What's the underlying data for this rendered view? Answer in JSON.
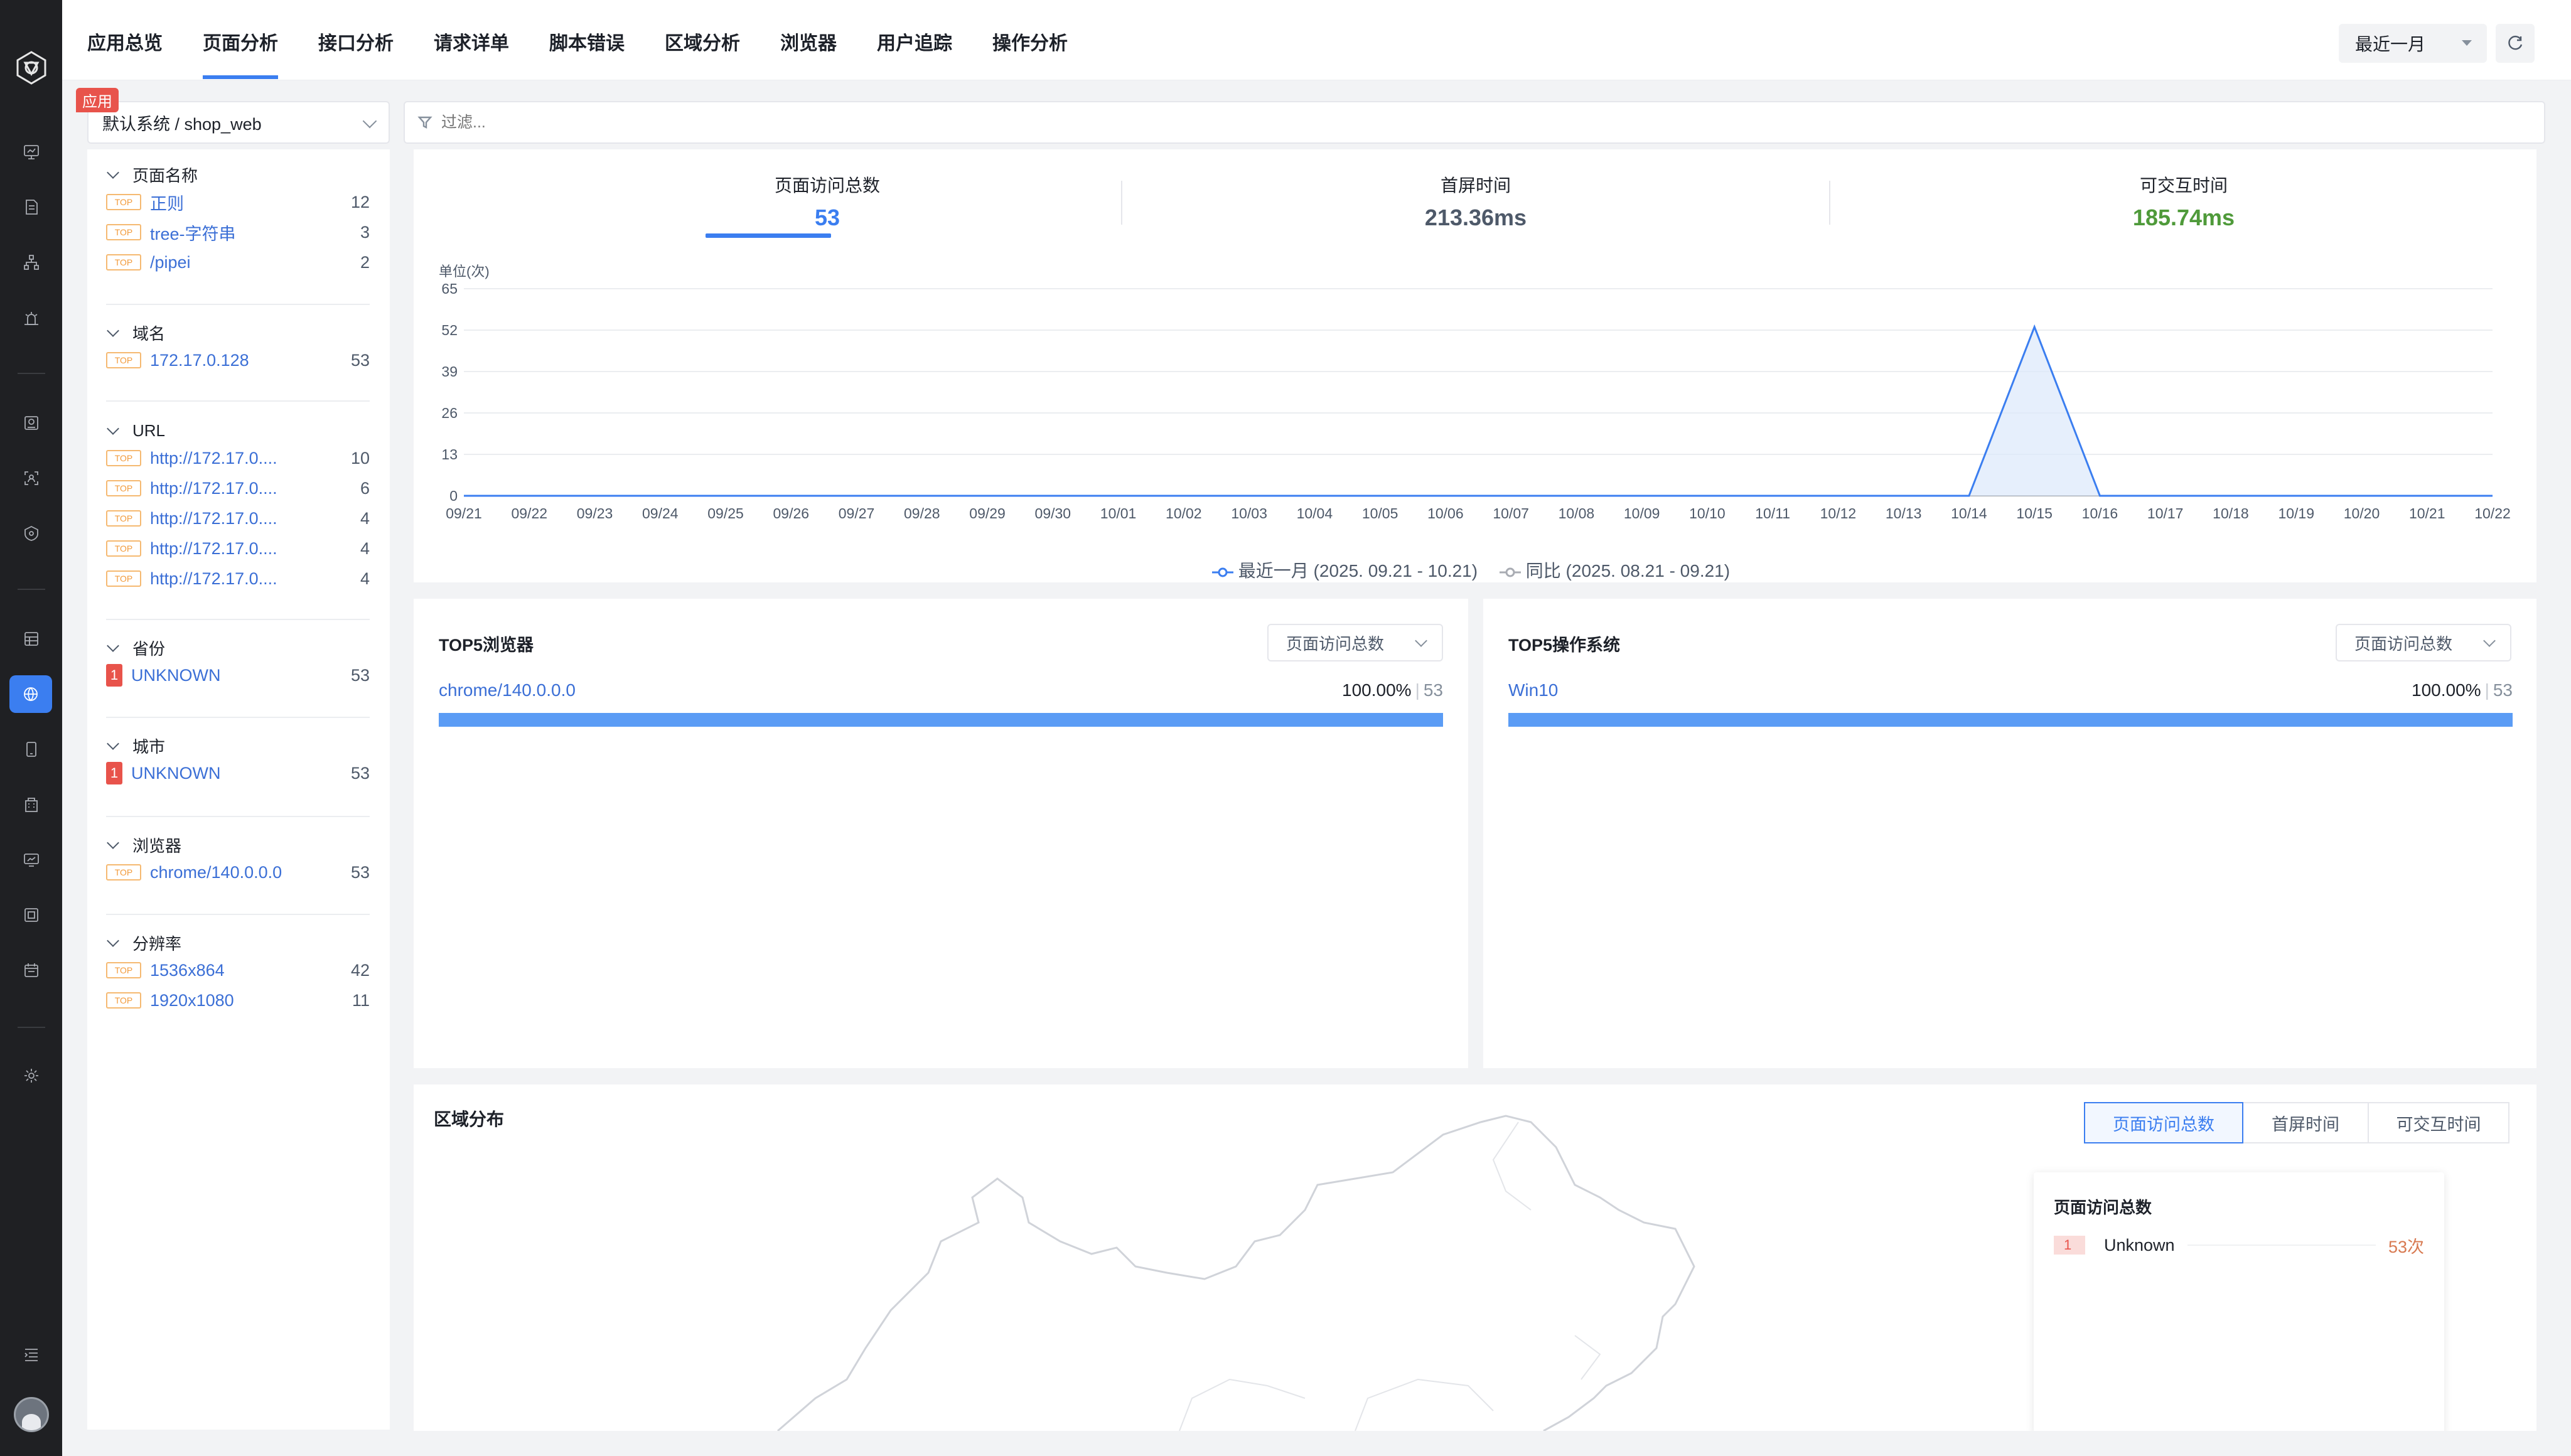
{
  "nav": {
    "tabs": [
      "应用总览",
      "页面分析",
      "接口分析",
      "请求详单",
      "脚本错误",
      "区域分析",
      "浏览器",
      "用户追踪",
      "操作分析"
    ],
    "active_tab": "页面分析",
    "range": "最近一月"
  },
  "app_selector": {
    "badge": "应用",
    "value": "默认系统 / shop_web"
  },
  "filter": {
    "placeholder": "过滤..."
  },
  "facets": [
    {
      "title": "页面名称",
      "rows": [
        {
          "badge": "TOP",
          "label": "正则",
          "count": "12"
        },
        {
          "badge": "TOP",
          "label": "tree-字符串",
          "count": "3"
        },
        {
          "badge": "TOP",
          "label": "/pipei",
          "count": "2"
        }
      ]
    },
    {
      "title": "域名",
      "rows": [
        {
          "badge": "TOP",
          "label": "172.17.0.128",
          "count": "53"
        }
      ]
    },
    {
      "title": "URL",
      "rows": [
        {
          "badge": "TOP",
          "label": "http://172.17.0....",
          "count": "10"
        },
        {
          "badge": "TOP",
          "label": "http://172.17.0....",
          "count": "6"
        },
        {
          "badge": "TOP",
          "label": "http://172.17.0....",
          "count": "4"
        },
        {
          "badge": "TOP",
          "label": "http://172.17.0....",
          "count": "4"
        },
        {
          "badge": "TOP",
          "label": "http://172.17.0....",
          "count": "4"
        }
      ]
    },
    {
      "title": "省份",
      "rows": [
        {
          "badge": "1",
          "label": "UNKNOWN",
          "count": "53"
        }
      ]
    },
    {
      "title": "城市",
      "rows": [
        {
          "badge": "1",
          "label": "UNKNOWN",
          "count": "53"
        }
      ]
    },
    {
      "title": "浏览器",
      "rows": [
        {
          "badge": "TOP",
          "label": "chrome/140.0.0.0",
          "count": "53"
        }
      ]
    },
    {
      "title": "分辨率",
      "rows": [
        {
          "badge": "TOP",
          "label": "1536x864",
          "count": "42"
        },
        {
          "badge": "TOP",
          "label": "1920x1080",
          "count": "11"
        }
      ]
    }
  ],
  "metrics": [
    {
      "label": "页面访问总数",
      "value": "53",
      "color": "#3b7ef0"
    },
    {
      "label": "首屏时间",
      "value": "213.36ms",
      "color": "#4e5969"
    },
    {
      "label": "可交互时间",
      "value": "185.74ms",
      "color": "#4f9a3a"
    }
  ],
  "chart_data": {
    "type": "area",
    "unit_label": "单位(次)",
    "ylim": [
      0,
      65
    ],
    "yticks": [
      0,
      13,
      26,
      39,
      52,
      65
    ],
    "categories": [
      "09/21",
      "09/22",
      "09/23",
      "09/24",
      "09/25",
      "09/26",
      "09/27",
      "09/28",
      "09/29",
      "09/30",
      "10/01",
      "10/02",
      "10/03",
      "10/04",
      "10/05",
      "10/06",
      "10/07",
      "10/08",
      "10/09",
      "10/10",
      "10/11",
      "10/12",
      "10/13",
      "10/14",
      "10/15",
      "10/16",
      "10/17",
      "10/18",
      "10/19",
      "10/20",
      "10/21",
      "10/22"
    ],
    "series": [
      {
        "name": "最近一月 (2025. 09.21 - 10.21)",
        "color": "#3b7ef0",
        "values": [
          0,
          0,
          0,
          0,
          0,
          0,
          0,
          0,
          0,
          0,
          0,
          0,
          0,
          0,
          0,
          0,
          0,
          0,
          0,
          0,
          0,
          0,
          0,
          0,
          53,
          0,
          0,
          0,
          0,
          0,
          0,
          0
        ]
      },
      {
        "name": "同比 (2025. 08.21 - 09.21)",
        "color": "#a9acb3",
        "values": [
          0,
          0,
          0,
          0,
          0,
          0,
          0,
          0,
          0,
          0,
          0,
          0,
          0,
          0,
          0,
          0,
          0,
          0,
          0,
          0,
          0,
          0,
          0,
          0,
          0,
          0,
          0,
          0,
          0,
          0,
          0,
          0
        ]
      }
    ],
    "grid": true,
    "legend": "bottom"
  },
  "browser_card": {
    "title": "TOP5浏览器",
    "select": "页面访问总数",
    "items": [
      {
        "label": "chrome/140.0.0.0",
        "pct": "100.00%",
        "count": "53",
        "fraction": 1.0
      }
    ]
  },
  "os_card": {
    "title": "TOP5操作系统",
    "select": "页面访问总数",
    "items": [
      {
        "label": "Win10",
        "pct": "100.00%",
        "count": "53",
        "fraction": 1.0
      }
    ]
  },
  "region": {
    "title": "区域分布",
    "segments": [
      "页面访问总数",
      "首屏时间",
      "可交互时间"
    ],
    "active_segment": "页面访问总数",
    "panel_title": "页面访问总数",
    "rows": [
      {
        "rank": "1",
        "name": "Unknown",
        "value": "53次"
      }
    ]
  },
  "icons": [
    "logo-icon",
    "monitor-icon",
    "document-icon",
    "topology-icon",
    "bug-icon",
    "database-icon",
    "scan-icon",
    "shield-icon",
    "table-icon",
    "globe-icon",
    "mobile-icon",
    "building-icon",
    "screen-icon",
    "frame-icon",
    "calendar-icon",
    "settings-icon",
    "collapse-icon",
    "avatar"
  ]
}
